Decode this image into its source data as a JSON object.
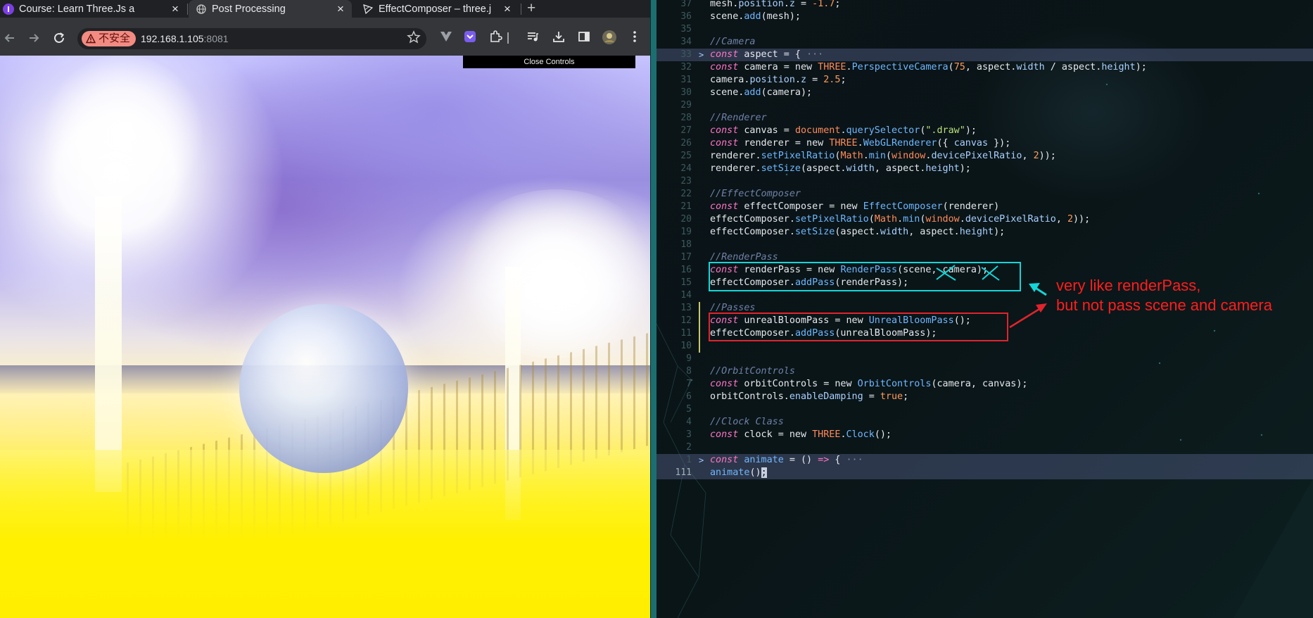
{
  "browser": {
    "tabs": [
      {
        "title": "Course: Learn Three.Js a",
        "close": "×",
        "favicon": "purple-course-icon"
      },
      {
        "title": "Post Processing",
        "close": "×",
        "favicon": "globe-icon"
      },
      {
        "title": "EffectComposer – three.j",
        "close": "×",
        "favicon": "threejs-icon"
      }
    ],
    "new_tab": "+",
    "omnibox": {
      "security_label": "不安全",
      "host": "192.168.1.105",
      "port": ":8081"
    },
    "toolbar_icons": [
      "back-icon",
      "forward-icon",
      "reload-icon",
      "star-icon",
      "vue-devtools-icon",
      "extension-shield-icon",
      "extensions-icon",
      "media-queue-icon",
      "download-icon",
      "side-panel-icon",
      "profile-avatar-icon",
      "menu-icon"
    ]
  },
  "page": {
    "close_controls_label": "Close Controls"
  },
  "editor": {
    "lines": [
      {
        "n": "37",
        "code": "mesh.position.z = -1.7;"
      },
      {
        "n": "36",
        "code": "scene.add(mesh);"
      },
      {
        "n": "35",
        "code": ""
      },
      {
        "n": "34",
        "code": "//Camera"
      },
      {
        "n": "33",
        "code": "const aspect = { ···"
      },
      {
        "n": "32",
        "code": "const camera = new THREE.PerspectiveCamera(75, aspect.width / aspect.height);"
      },
      {
        "n": "31",
        "code": "camera.position.z = 2.5;"
      },
      {
        "n": "30",
        "code": "scene.add(camera);"
      },
      {
        "n": "29",
        "code": ""
      },
      {
        "n": "28",
        "code": "//Renderer"
      },
      {
        "n": "27",
        "code": "const canvas = document.querySelector(\".draw\");"
      },
      {
        "n": "26",
        "code": "const renderer = new THREE.WebGLRenderer({ canvas });"
      },
      {
        "n": "25",
        "code": "renderer.setPixelRatio(Math.min(window.devicePixelRatio, 2));"
      },
      {
        "n": "24",
        "code": "renderer.setSize(aspect.width, aspect.height);"
      },
      {
        "n": "23",
        "code": ""
      },
      {
        "n": "22",
        "code": "//EffectComposer"
      },
      {
        "n": "21",
        "code": "const effectComposer = new EffectComposer(renderer)"
      },
      {
        "n": "20",
        "code": "effectComposer.setPixelRatio(Math.min(window.devicePixelRatio, 2));"
      },
      {
        "n": "19",
        "code": "effectComposer.setSize(aspect.width, aspect.height);"
      },
      {
        "n": "18",
        "code": ""
      },
      {
        "n": "17",
        "code": "//RenderPass"
      },
      {
        "n": "16",
        "code": "const renderPass = new RenderPass(scene, camera);"
      },
      {
        "n": "15",
        "code": "effectComposer.addPass(renderPass);"
      },
      {
        "n": "14",
        "code": ""
      },
      {
        "n": "13",
        "code": "//Passes"
      },
      {
        "n": "12",
        "code": "const unrealBloomPass = new UnrealBloomPass();"
      },
      {
        "n": "11",
        "code": "effectComposer.addPass(unrealBloomPass);"
      },
      {
        "n": "10",
        "code": ""
      },
      {
        "n": "9",
        "code": ""
      },
      {
        "n": "8",
        "code": "//OrbitControls"
      },
      {
        "n": "7",
        "code": "const orbitControls = new OrbitControls(camera, canvas);"
      },
      {
        "n": "6",
        "code": "orbitControls.enableDamping = true;"
      },
      {
        "n": "5",
        "code": ""
      },
      {
        "n": "4",
        "code": "//Clock Class"
      },
      {
        "n": "3",
        "code": "const clock = new THREE.Clock();"
      },
      {
        "n": "2",
        "code": ""
      },
      {
        "n": "1",
        "code": "const animate = () => { ···"
      },
      {
        "n": "111",
        "code": "animate();"
      }
    ]
  },
  "annotation": {
    "line1": "very like renderPass,",
    "line2": "but not pass scene and camera",
    "cyan_color": "#14d6d8",
    "red_color": "#e0242c"
  }
}
